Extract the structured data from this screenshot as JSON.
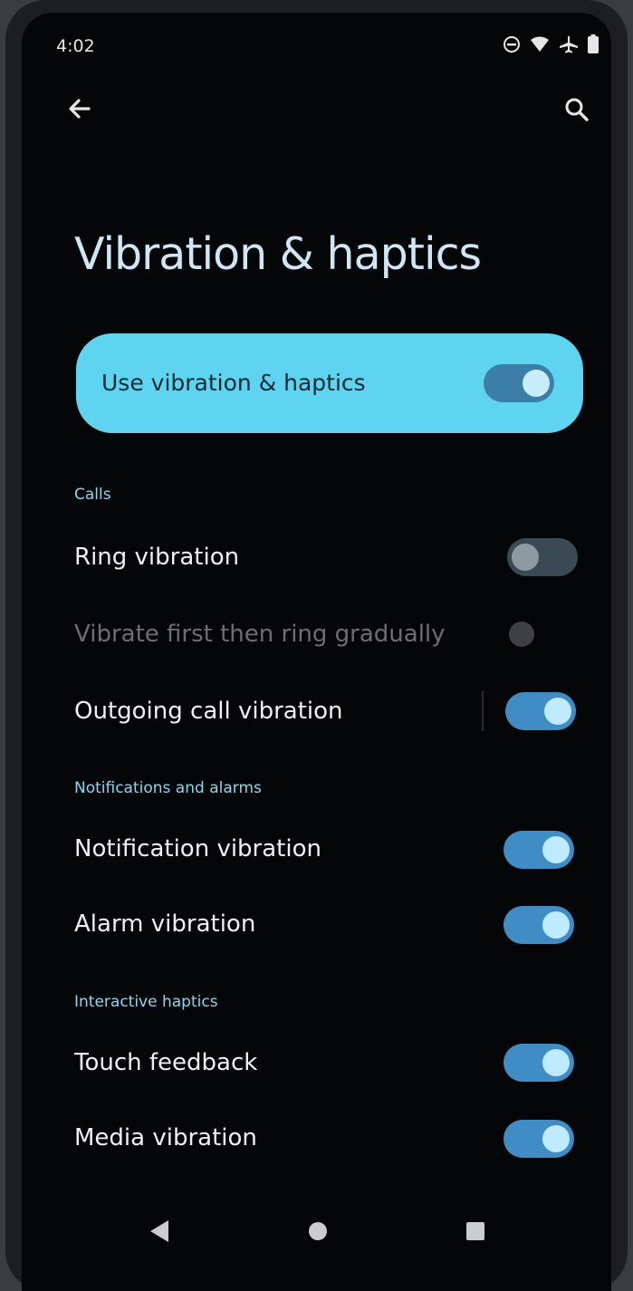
{
  "status_bar": {
    "time": "4:02",
    "icons": [
      "do-not-disturb-icon",
      "wifi-icon",
      "airplane-icon",
      "battery-icon"
    ]
  },
  "toolbar": {
    "back_icon": "back-arrow-icon",
    "search_icon": "search-icon"
  },
  "page": {
    "title": "Vibration & haptics"
  },
  "master_switch": {
    "label": "Use vibration & haptics",
    "on": true
  },
  "sections": [
    {
      "header": "Calls",
      "items": [
        {
          "label": "Ring vibration",
          "state": "off"
        },
        {
          "label": "Vibrate first then ring gradually",
          "state": "disabled"
        },
        {
          "label": "Outgoing call vibration",
          "state": "on"
        }
      ]
    },
    {
      "header": "Notifications and alarms",
      "items": [
        {
          "label": "Notification vibration",
          "state": "on"
        },
        {
          "label": "Alarm vibration",
          "state": "on"
        }
      ]
    },
    {
      "header": "Interactive haptics",
      "items": [
        {
          "label": "Touch feedback",
          "state": "on"
        },
        {
          "label": "Media vibration",
          "state": "on"
        }
      ]
    }
  ],
  "nav_bar": {
    "back_icon": "nav-back-icon",
    "home_icon": "nav-home-icon",
    "recents_icon": "nav-recents-icon"
  },
  "colors": {
    "accent": "#5ed4f0",
    "switch_on": "#3f8dc4",
    "knob_on": "#bfeaff",
    "background": "#050607"
  }
}
